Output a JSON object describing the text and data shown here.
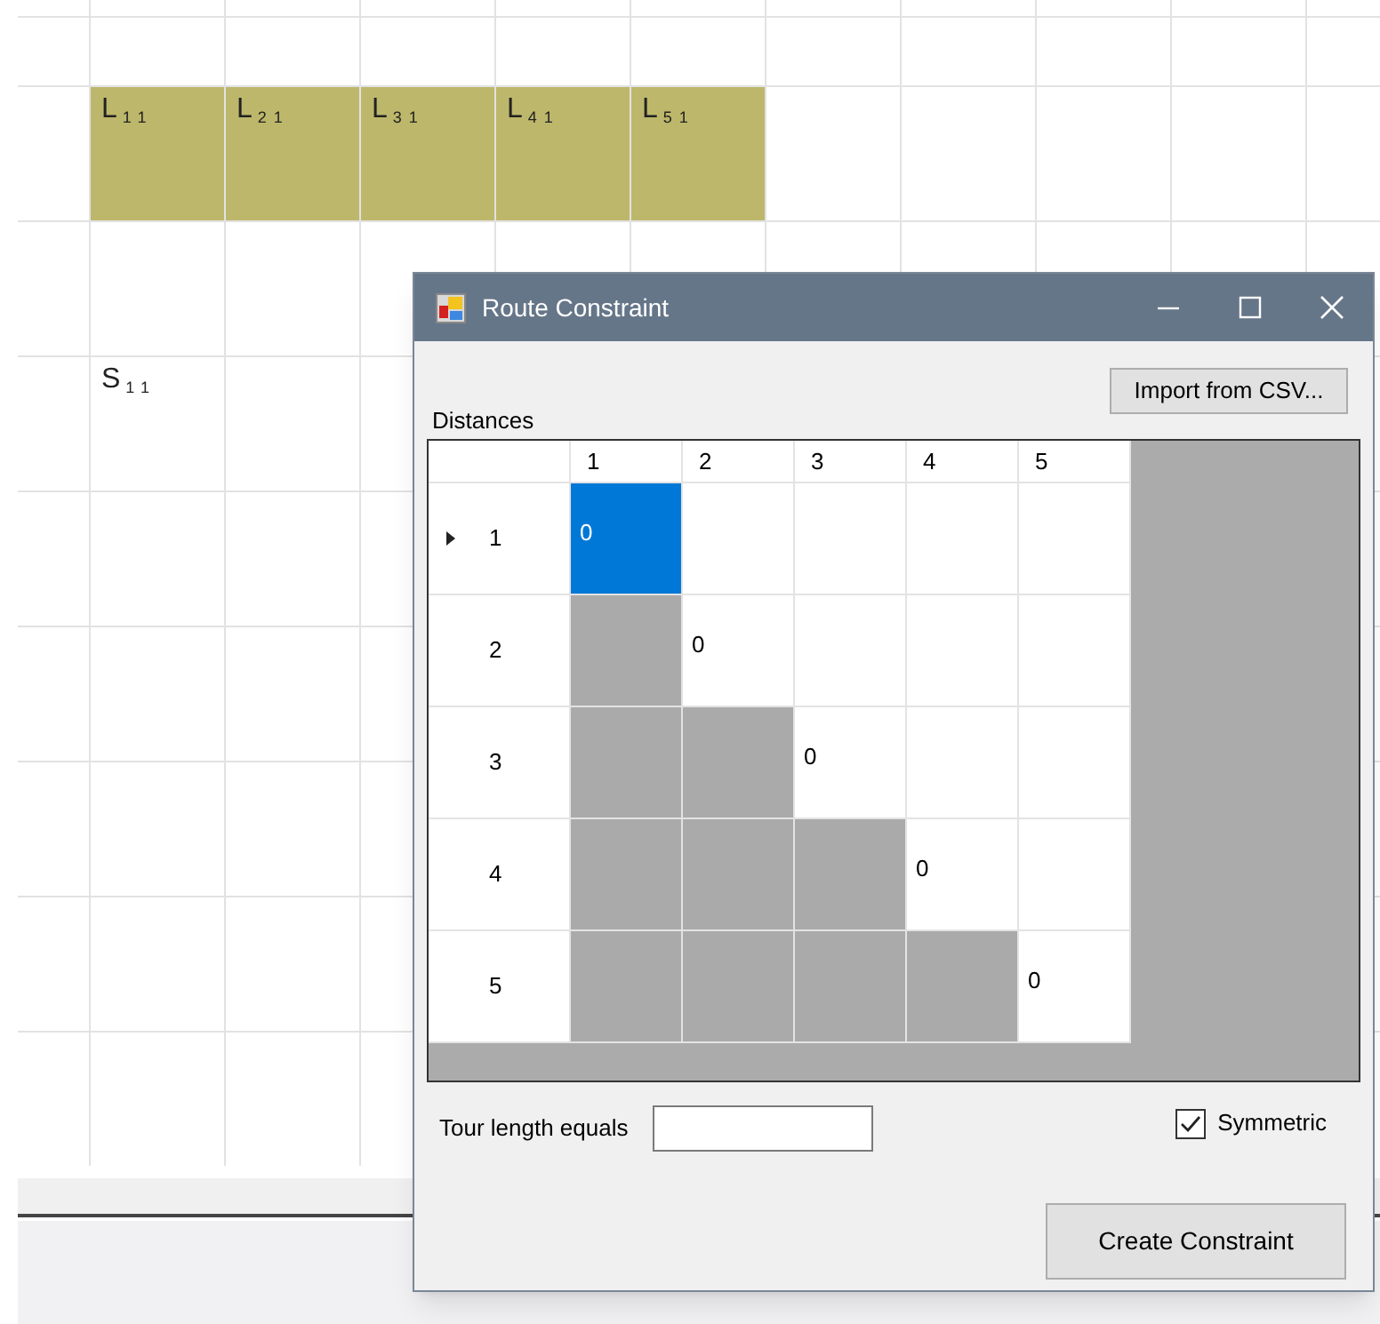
{
  "sheet": {
    "rows": [
      {
        "cells": [
          {
            "highlighted": false
          },
          {
            "highlighted": false
          },
          {
            "highlighted": false
          },
          {
            "highlighted": false
          },
          {
            "highlighted": false
          },
          {
            "highlighted": false
          },
          {
            "highlighted": false
          },
          {
            "highlighted": false
          },
          {
            "highlighted": false
          },
          {
            "highlighted": false
          },
          {
            "highlighted": false
          }
        ]
      },
      {
        "cells": [
          {
            "highlighted": false
          },
          {
            "highlighted": false
          },
          {
            "highlighted": false
          },
          {
            "highlighted": false
          },
          {
            "highlighted": false
          },
          {
            "highlighted": false
          },
          {
            "highlighted": false
          },
          {
            "highlighted": false
          },
          {
            "highlighted": false
          },
          {
            "highlighted": false
          },
          {
            "highlighted": false
          }
        ]
      },
      {
        "cells": [
          {
            "highlighted": false
          },
          {
            "text": "L$_{11}$",
            "highlighted": true
          },
          {
            "text": "L$_{21}$",
            "highlighted": true
          },
          {
            "text": "L$_{31}$",
            "highlighted": true
          },
          {
            "text": "L$_{41}$",
            "highlighted": true
          },
          {
            "text": "L$_{51}$",
            "highlighted": true
          },
          {
            "highlighted": false
          },
          {
            "highlighted": false
          },
          {
            "highlighted": false
          },
          {
            "highlighted": false
          },
          {
            "highlighted": false
          }
        ]
      },
      {
        "cells": [
          {
            "highlighted": false
          },
          {
            "highlighted": false
          },
          {
            "highlighted": false
          },
          {
            "highlighted": false
          },
          {
            "highlighted": false
          },
          {
            "highlighted": false
          },
          {
            "highlighted": false
          },
          {
            "highlighted": false
          },
          {
            "highlighted": false
          },
          {
            "highlighted": false
          },
          {
            "highlighted": false
          }
        ]
      },
      {
        "cells": [
          {
            "highlighted": false
          },
          {
            "text": "S$_{11}$",
            "highlighted": false
          },
          {
            "highlighted": false
          },
          {
            "highlighted": false
          }
        ]
      },
      {
        "cells": [
          {
            "highlighted": false
          },
          {
            "highlighted": false
          },
          {
            "highlighted": false
          },
          {
            "highlighted": false
          }
        ]
      },
      {
        "cells": [
          {
            "highlighted": false
          },
          {
            "highlighted": false
          },
          {
            "highlighted": false
          },
          {
            "highlighted": false
          }
        ]
      },
      {
        "cells": [
          {
            "highlighted": false
          },
          {
            "highlighted": false
          },
          {
            "highlighted": false
          },
          {
            "highlighted": false
          }
        ]
      },
      {
        "cells": [
          {
            "highlighted": false
          },
          {
            "highlighted": false
          },
          {
            "highlighted": false
          },
          {
            "highlighted": false
          }
        ]
      },
      {
        "cells": [
          {
            "highlighted": false
          },
          {
            "highlighted": false
          },
          {
            "highlighted": false
          },
          {
            "highlighted": false
          }
        ]
      }
    ]
  },
  "dialog": {
    "title": "Route Constraint",
    "distances_label": "Distances",
    "import_button": "Import from CSV...",
    "grid": {
      "columns": [
        "1",
        "2",
        "3",
        "4",
        "5"
      ],
      "rows": [
        {
          "header": "1",
          "current": true,
          "cells": [
            {
              "value": "0",
              "selected": true,
              "disabled": false
            },
            {
              "selected": false,
              "disabled": false
            },
            {
              "selected": false,
              "disabled": false
            },
            {
              "selected": false,
              "disabled": false
            },
            {
              "selected": false,
              "disabled": false
            }
          ]
        },
        {
          "header": "2",
          "current": false,
          "cells": [
            {
              "selected": false,
              "disabled": true
            },
            {
              "value": "0",
              "selected": false,
              "disabled": false
            },
            {
              "selected": false,
              "disabled": false
            },
            {
              "selected": false,
              "disabled": false
            },
            {
              "selected": false,
              "disabled": false
            }
          ]
        },
        {
          "header": "3",
          "current": false,
          "cells": [
            {
              "selected": false,
              "disabled": true
            },
            {
              "selected": false,
              "disabled": true
            },
            {
              "value": "0",
              "selected": false,
              "disabled": false
            },
            {
              "selected": false,
              "disabled": false
            },
            {
              "selected": false,
              "disabled": false
            }
          ]
        },
        {
          "header": "4",
          "current": false,
          "cells": [
            {
              "selected": false,
              "disabled": true
            },
            {
              "selected": false,
              "disabled": true
            },
            {
              "selected": false,
              "disabled": true
            },
            {
              "value": "0",
              "selected": false,
              "disabled": false
            },
            {
              "selected": false,
              "disabled": false
            }
          ]
        },
        {
          "header": "5",
          "current": false,
          "cells": [
            {
              "selected": false,
              "disabled": true
            },
            {
              "selected": false,
              "disabled": true
            },
            {
              "selected": false,
              "disabled": true
            },
            {
              "selected": false,
              "disabled": true
            },
            {
              "value": "0",
              "selected": false,
              "disabled": false
            }
          ]
        }
      ]
    },
    "tour_label": "Tour length equals",
    "symmetric": {
      "label": "Symmetric",
      "checked": true
    },
    "create_button": "Create Constraint"
  }
}
